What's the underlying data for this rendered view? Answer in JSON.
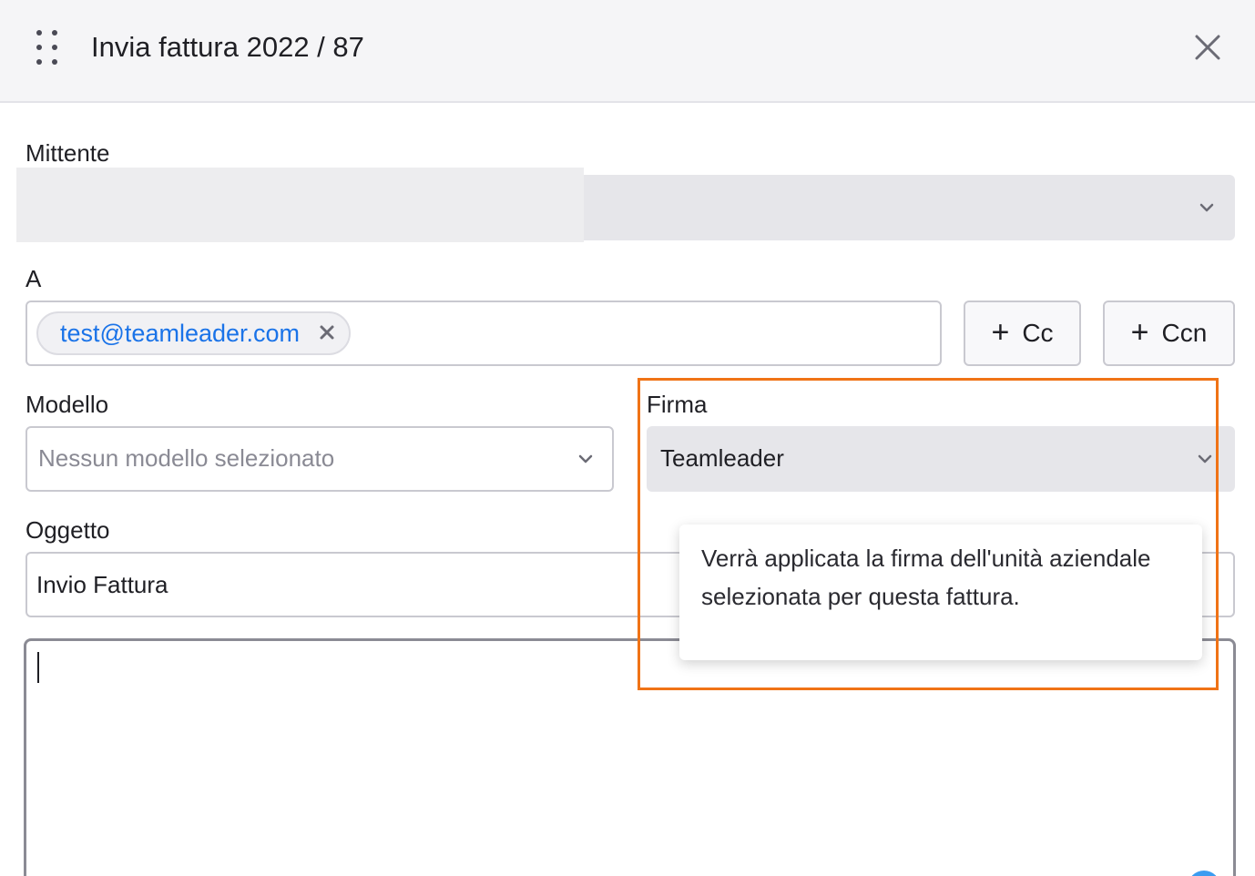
{
  "header": {
    "title": "Invia fattura 2022 / 87"
  },
  "sender": {
    "label": "Mittente"
  },
  "to": {
    "label": "A",
    "recipient": "test@teamleader.com"
  },
  "buttons": {
    "cc": "Cc",
    "bcc": "Ccn",
    "plus": "+"
  },
  "template": {
    "label": "Modello",
    "placeholder": "Nessun modello selezionato"
  },
  "signature": {
    "label": "Firma",
    "value": "Teamleader",
    "tooltip": "Verrà applicata la firma dell'unità aziendale selezionata per questa fattura."
  },
  "subject": {
    "label": "Oggetto",
    "value": "Invio Fattura"
  },
  "colors": {
    "accent": "#1a73e8",
    "highlight": "#f07316",
    "surface": "#e6e6ea"
  }
}
